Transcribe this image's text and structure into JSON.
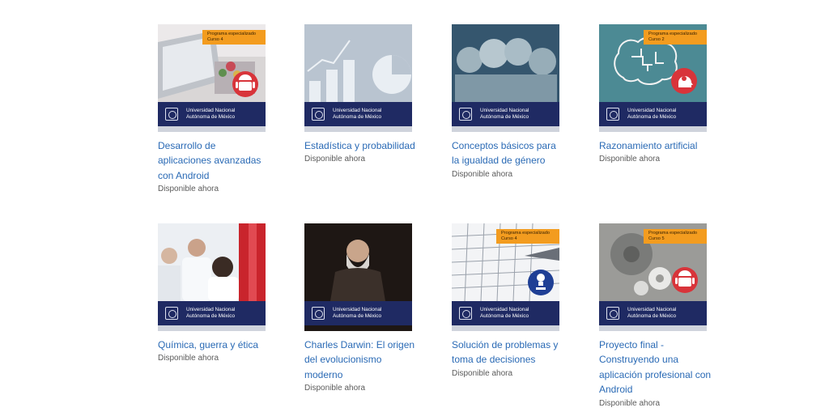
{
  "university": {
    "line1": "Universidad Nacional",
    "line2": "Autónoma de México"
  },
  "courses": [
    {
      "title": "Desarrollo de aplicaciones avanzadas con Android",
      "status": "Disponible ahora",
      "tag": {
        "line1": "Programa especializado",
        "line2": "Curso 4"
      },
      "icon": "android-icon"
    },
    {
      "title": "Estadística y probabilidad",
      "status": "Disponible ahora"
    },
    {
      "title": "Conceptos básicos para la igualdad de género",
      "status": "Disponible ahora"
    },
    {
      "title": "Razonamiento artificial",
      "status": "Disponible ahora",
      "tag": {
        "line1": "Programa especializado",
        "line2": "Curso 2"
      },
      "icon": "brain-head-icon"
    },
    {
      "title": "Química, guerra y ética",
      "status": "Disponible ahora"
    },
    {
      "title": "Charles Darwin: El origen del evolucionismo moderno",
      "status": "Disponible ahora"
    },
    {
      "title": "Solución de problemas y toma de decisiones",
      "status": "Disponible ahora",
      "tag": {
        "line1": "Programa especializado",
        "line2": "Curso 4"
      },
      "icon": "lightbulb-person-icon"
    },
    {
      "title": "Proyecto final - Construyendo una aplicación profesional con Android",
      "status": "Disponible ahora",
      "tag": {
        "line1": "Programa especializado",
        "line2": "Curso 5"
      },
      "icon": "android-icon"
    }
  ],
  "colors": {
    "link": "#2a6ab5",
    "banner": "#1f2a63",
    "tag": "#f39c1f",
    "badge": "#d8343a"
  }
}
